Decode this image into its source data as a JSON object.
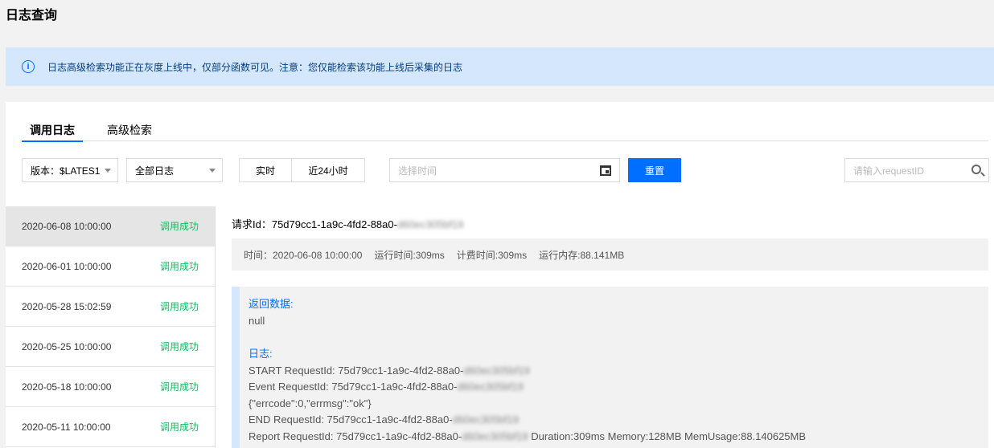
{
  "page_title": "日志查询",
  "notice": {
    "icon": "info-icon",
    "text": "日志高级检索功能正在灰度上线中，仅部分函数可见。注意：您仅能检索该功能上线后采集的日志"
  },
  "tabs": [
    {
      "label": "调用日志",
      "active": true
    },
    {
      "label": "高级检索",
      "active": false
    }
  ],
  "toolbar": {
    "version_select": "版本：$LATES1",
    "log_type_select": "全部日志",
    "realtime_button": "实时",
    "last24h_button": "近24小时",
    "time_placeholder": "选择时间",
    "reset_button": "重置",
    "search_placeholder": "请输入requestID"
  },
  "log_list": [
    {
      "date": "2020-06-08 10:00:00",
      "status": "调用成功"
    },
    {
      "date": "2020-06-01 10:00:00",
      "status": "调用成功"
    },
    {
      "date": "2020-05-28 15:02:59",
      "status": "调用成功"
    },
    {
      "date": "2020-05-25 10:00:00",
      "status": "调用成功"
    },
    {
      "date": "2020-05-18 10:00:00",
      "status": "调用成功"
    },
    {
      "date": "2020-05-11 10:00:00",
      "status": "调用成功"
    }
  ],
  "detail": {
    "request_label": "请求Id：",
    "request_id": "75d79cc1-1a9c-4fd2-88a0-",
    "request_id_hidden": "d60ec305bf19",
    "meta": {
      "time": "时间：2020-06-08 10:00:00",
      "run_time": "运行时间:309ms",
      "billed_time": "计费时间:309ms",
      "memory": "运行内存:88.141MB"
    },
    "return_label": "返回数据:",
    "return_value": "null",
    "log_label": "日志:",
    "log_lines": [
      {
        "text": "START RequestId: 75d79cc1-1a9c-4fd2-88a0-",
        "hidden": "d60ec305bf19",
        "suffix": ""
      },
      {
        "text": "Event RequestId: 75d79cc1-1a9c-4fd2-88a0-",
        "hidden": "d60ec305bf19",
        "suffix": ""
      },
      {
        "text": "{\"errcode\":0,\"errmsg\":\"ok\"}",
        "hidden": "",
        "suffix": ""
      },
      {
        "text": "END RequestId: 75d79cc1-1a9c-4fd2-88a0-",
        "hidden": "d60ec305bf19",
        "suffix": ""
      },
      {
        "text": "Report RequestId: 75d79cc1-1a9c-4fd2-88a0-",
        "hidden": "d60ec305bf19",
        "suffix": " Duration:309ms Memory:128MB MemUsage:88.140625MB"
      }
    ]
  },
  "colors": {
    "primary": "#006eff",
    "success": "#0abf5b",
    "notice_bg": "#d5e7fd"
  }
}
